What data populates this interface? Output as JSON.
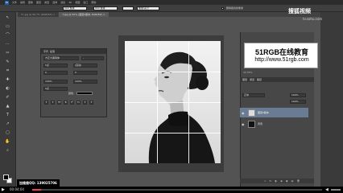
{
  "app": {
    "menu_items": [
      "文件",
      "编辑",
      "图像",
      "图层",
      "类型",
      "选择",
      "滤镜",
      "3D",
      "视图",
      "窗口",
      "帮助"
    ]
  },
  "options_bar": {
    "width_value": "600 像素",
    "height_value": "800 像素",
    "units_label": "像素/英寸",
    "check_label": "删除裁剪的像素"
  },
  "tabs": [
    {
      "label": "T1.jpg @ 66.7% (RGB/8#) ×",
      "active": false
    },
    {
      "label": "T.jpg @ 50% (图层0副本, RGB/8#) ×",
      "active": true
    }
  ],
  "toolbar": {
    "tools": [
      "↖",
      "▭",
      "⌒",
      "⋯",
      "✂",
      "✎",
      "⌗",
      "✚",
      "◐",
      "✐",
      "▲",
      "T",
      "↗",
      "▢",
      "✋",
      "⌕"
    ]
  },
  "character_panel": {
    "tabs": [
      "字符",
      "段落"
    ],
    "font_family": "方正大黑简体",
    "font_style": "-",
    "size": "5点",
    "leading": "(自动)",
    "tracking": "0",
    "kerning": "0",
    "scale_v": "100%",
    "scale_h": "100%",
    "baseline": "0点",
    "color_label": "颜色:",
    "style_buttons": [
      "T",
      "T",
      "TT",
      "Tr",
      "T¹",
      "T₁",
      "T",
      "T"
    ]
  },
  "brand": {
    "title": "51RGB在线教育",
    "url": "http://www.51rgb.com"
  },
  "right_panel": {
    "zoom": "33.33%",
    "layer_tabs": [
      "图层",
      "通道",
      "路径"
    ],
    "blend_mode": "正常",
    "opacity": "100%",
    "fill": "100%",
    "layers": [
      {
        "name": "图层0副本",
        "selected": true,
        "kind": "portrait"
      },
      {
        "name": "背景",
        "selected": false,
        "kind": "black"
      }
    ],
    "footer_icons": [
      "∞",
      "fx",
      "◧",
      "◉",
      "▣",
      "▤",
      "🗑"
    ]
  },
  "watermark": {
    "brand": "搜狐视频",
    "sub": "tv.sohu.com"
  },
  "status": {
    "contact": "加维维QQ: 139025706"
  },
  "player": {
    "time": "00:04:04",
    "progress": 0.03
  }
}
